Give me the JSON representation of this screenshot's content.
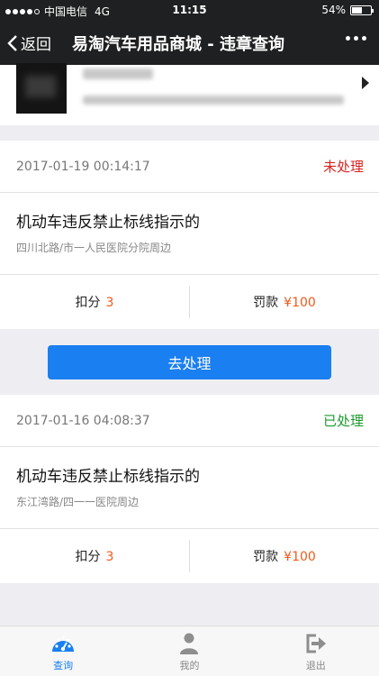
{
  "status_bar": {
    "carrier": "中国电信",
    "network": "4G",
    "time": "11:15",
    "battery": "54%",
    "battery_level": 0.54
  },
  "nav": {
    "back_label": "返回",
    "title": "易淘汽车用品商城 - 违章查询"
  },
  "records": [
    {
      "time": "2017-01-19 00:14:17",
      "status": "未处理",
      "status_color": "#d9231e",
      "title": "机动车违反禁止标线指示的",
      "location": "四川北路/市一人民医院分院周边",
      "points_label": "扣分",
      "points": "3",
      "fine_label": "罚款",
      "fine": "¥100",
      "action_label": "去处理"
    },
    {
      "time": "2017-01-16 04:08:37",
      "status": "已处理",
      "status_color": "#1a9a2e",
      "title": "机动车违反禁止标线指示的",
      "location": "东江湾路/四一一医院周边",
      "points_label": "扣分",
      "points": "3",
      "fine_label": "罚款",
      "fine": "¥100"
    }
  ],
  "tabs": [
    {
      "label": "查询",
      "icon": "speedometer-icon",
      "active": true
    },
    {
      "label": "我的",
      "icon": "person-icon",
      "active": false
    },
    {
      "label": "退出",
      "icon": "exit-icon",
      "active": false
    }
  ],
  "colors": {
    "accent": "#1a7ff0",
    "highlight_number": "#f05a1a",
    "nav_background": "#1f2021"
  }
}
